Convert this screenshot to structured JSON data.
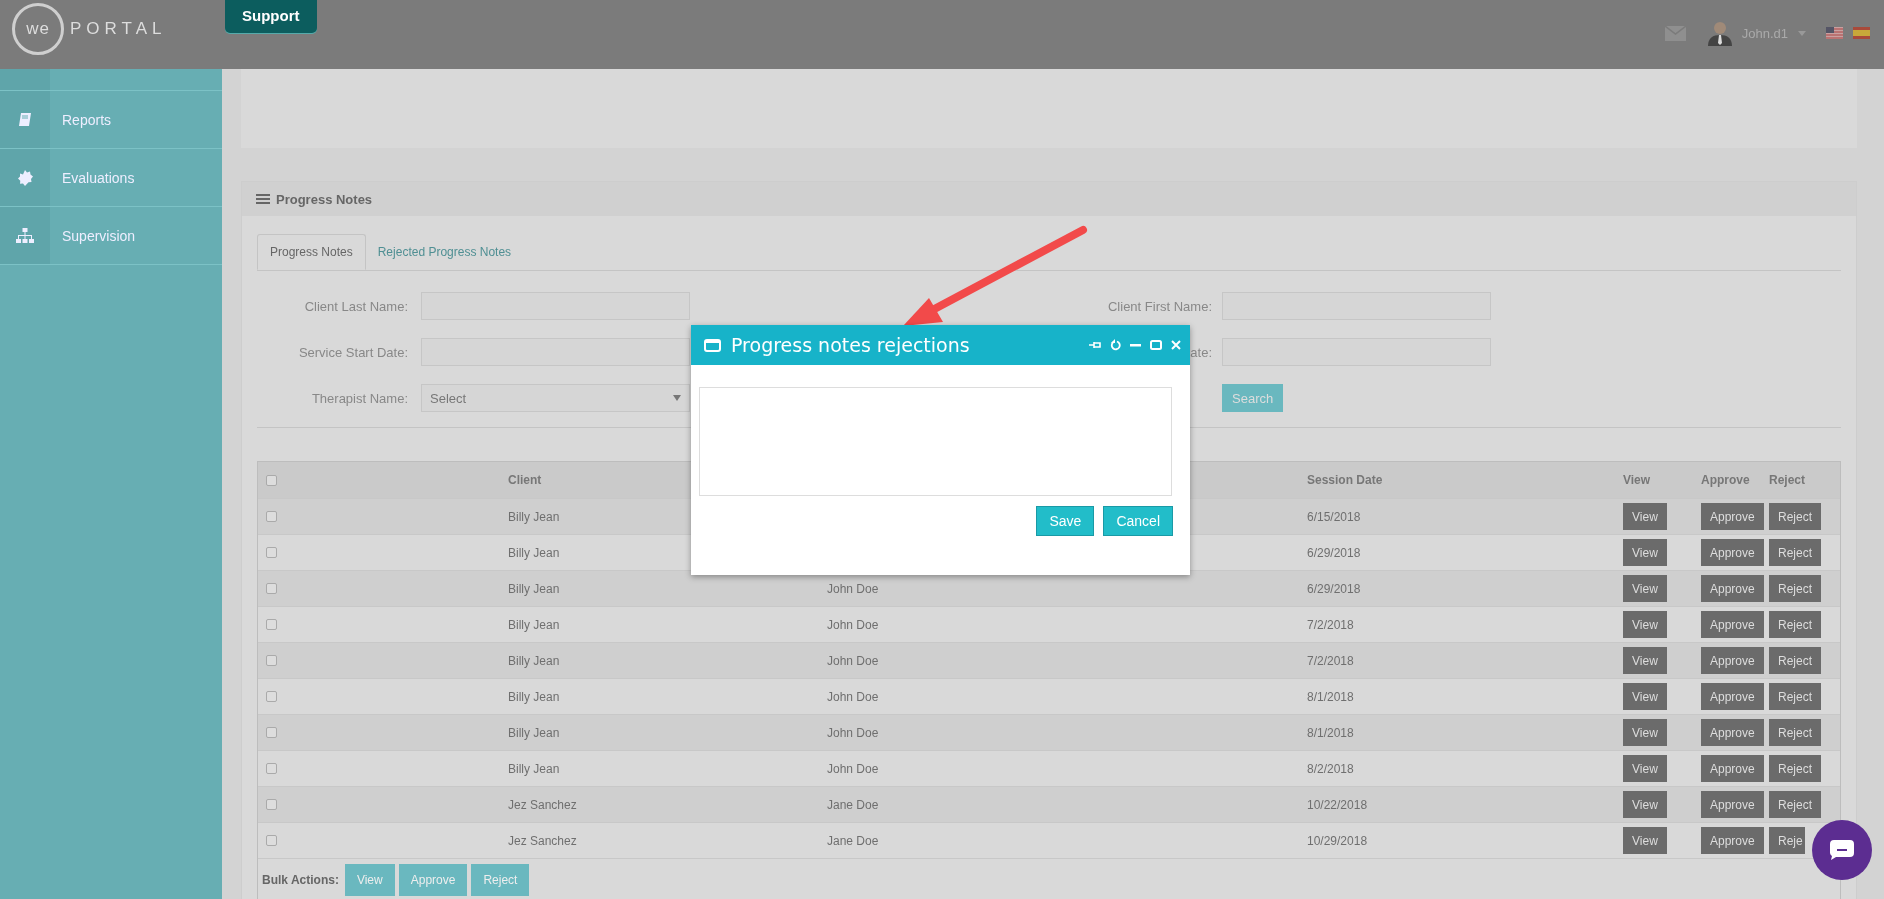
{
  "header": {
    "logo_mark": "we",
    "logo_text": "PORTAL",
    "support_tab": "Support",
    "user": "John.d1"
  },
  "sidebar": {
    "items": [
      {
        "label": "Reports"
      },
      {
        "label": "Evaluations"
      },
      {
        "label": "Supervision"
      }
    ]
  },
  "panel": {
    "title": "Progress Notes",
    "tabs": [
      {
        "label": "Progress Notes",
        "selected": true
      },
      {
        "label": "Rejected Progress Notes",
        "selected": false
      }
    ],
    "filters_left": [
      {
        "label": "Client Last Name:",
        "kind": "text"
      },
      {
        "label": "Service Start Date:",
        "kind": "text"
      },
      {
        "label": "Therapist Name:",
        "kind": "select",
        "value": "Select"
      }
    ],
    "filters_right": [
      {
        "label": "Client First Name:",
        "kind": "text"
      },
      {
        "label": "ate:",
        "kind": "text"
      },
      {
        "kind": "button",
        "label": "Search"
      }
    ]
  },
  "table": {
    "columns": [
      "Client",
      "Session Date",
      "View",
      "Approve",
      "Reject"
    ],
    "rows": [
      {
        "checked": false,
        "client": "Billy Jean",
        "session_date": "6/15/2018",
        "view": "View",
        "approve": "Approve",
        "reject": "Reject"
      },
      {
        "checked": false,
        "client": "Billy Jean",
        "session_date": "6/29/2018",
        "view": "View",
        "approve": "Approve",
        "reject": "Reject"
      },
      {
        "checked": false,
        "client": "Billy Jean",
        "therapist": "John Doe",
        "session_date": "6/29/2018",
        "view": "View",
        "approve": "Approve",
        "reject": "Reject"
      },
      {
        "checked": false,
        "client": "Billy Jean",
        "therapist": "John Doe",
        "session_date": "7/2/2018",
        "view": "View",
        "approve": "Approve",
        "reject": "Reject"
      },
      {
        "checked": false,
        "client": "Billy Jean",
        "therapist": "John Doe",
        "session_date": "7/2/2018",
        "view": "View",
        "approve": "Approve",
        "reject": "Reject"
      },
      {
        "checked": false,
        "client": "Billy Jean",
        "therapist": "John Doe",
        "session_date": "8/1/2018",
        "view": "View",
        "approve": "Approve",
        "reject": "Reject"
      },
      {
        "checked": false,
        "client": "Billy Jean",
        "therapist": "John Doe",
        "session_date": "8/1/2018",
        "view": "View",
        "approve": "Approve",
        "reject": "Reject"
      },
      {
        "checked": false,
        "client": "Billy Jean",
        "therapist": "John Doe",
        "session_date": "8/2/2018",
        "view": "View",
        "approve": "Approve",
        "reject": "Reject"
      },
      {
        "checked": false,
        "client": "Jez Sanchez",
        "therapist": "Jane Doe",
        "session_date": "10/22/2018",
        "view": "View",
        "approve": "Approve",
        "reject": "Reject"
      },
      {
        "checked": false,
        "client": "Jez Sanchez",
        "therapist": "Jane Doe",
        "session_date": "10/29/2018",
        "view": "View",
        "approve": "Approve",
        "reject": "Reje",
        "reject_cut": true
      }
    ],
    "header_checked": false,
    "bulk_label": "Bulk Actions:",
    "bulk_actions": [
      "View",
      "Approve",
      "Reject"
    ]
  },
  "modal": {
    "title": "Progress notes rejections",
    "buttons": [
      "Save",
      "Cancel"
    ]
  }
}
